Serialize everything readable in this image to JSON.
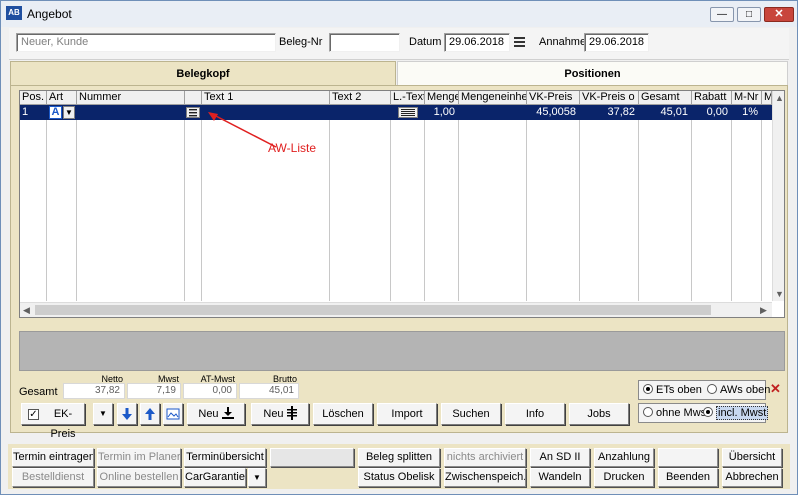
{
  "window": {
    "title": "Angebot",
    "app_icon_text": "AB",
    "minimize_glyph": "—",
    "maximize_glyph": "□",
    "close_glyph": "✕"
  },
  "header": {
    "customer_value": "Neuer, Kunde",
    "beleg_nr_label": "Beleg-Nr",
    "beleg_nr_value": "",
    "datum_label": "Datum",
    "datum_value": "29.06.2018",
    "annahme_label": "Annahme",
    "annahme_value": "29.06.2018"
  },
  "tabs": {
    "belegkopf": "Belegkopf",
    "positionen": "Positionen"
  },
  "grid": {
    "columns": [
      "Pos.",
      "Art",
      "Nummer",
      "",
      "Text 1",
      "Text 2",
      "L.-Text",
      "Menge",
      "Mengeneinheit",
      "VK-Preis",
      "VK-Preis o",
      "Gesamt",
      "Rabatt",
      "M-Nr",
      "M"
    ],
    "row": {
      "pos": "1",
      "art": "A",
      "menge": "1,00",
      "vk_preis": "45,0058",
      "vk_preis_o": "37,82",
      "gesamt": "45,01",
      "rabatt": "0,00",
      "mnr": "1%"
    }
  },
  "annotation": {
    "text": "AW-Liste",
    "color": "#e02020"
  },
  "totals": {
    "gesamt_label": "Gesamt",
    "netto_label": "Netto",
    "mwst_label": "Mwst",
    "at_mwst_label": "AT-Mwst",
    "brutto_label": "Brutto",
    "netto_value": "37,82",
    "mwst_value": "7,19",
    "at_mwst_value": "0,00",
    "brutto_value": "45,01"
  },
  "options": {
    "ets_oben": "ETs oben",
    "aws_oben": "AWs oben",
    "ohne_mwst": "ohne Mwst.",
    "incl_mwst": "incl. Mwst",
    "close_glyph": "✕"
  },
  "actions": {
    "ek_preis": "EK-Preis",
    "neu_1": "Neu",
    "neu_2": "Neu",
    "loeschen": "Löschen",
    "import": "Import",
    "suchen": "Suchen",
    "info": "Info",
    "jobs": "Jobs"
  },
  "bottom": {
    "row1": {
      "termin_eintragen": "Termin eintragen",
      "termin_im_planer": "Termin im Planer",
      "terminuebersicht": "Terminübersicht",
      "blank": "",
      "beleg_splitten": "Beleg splitten",
      "nicht_archiviert": "nichts archiviert",
      "an_sd_ii": "An SD II",
      "anzahlung": "Anzahlung",
      "empty": "",
      "uebersicht": "Übersicht"
    },
    "row2": {
      "bestelldienst": "Bestelldienst",
      "online_bestellen": "Online bestellen",
      "cargarantie": "CarGarantie",
      "status_obelisk": "Status Obelisk",
      "zwischenspeich": "Zwischenspeich.",
      "wandeln": "Wandeln",
      "drucken": "Drucken",
      "beenden": "Beenden",
      "abbrechen": "Abbrechen"
    }
  }
}
